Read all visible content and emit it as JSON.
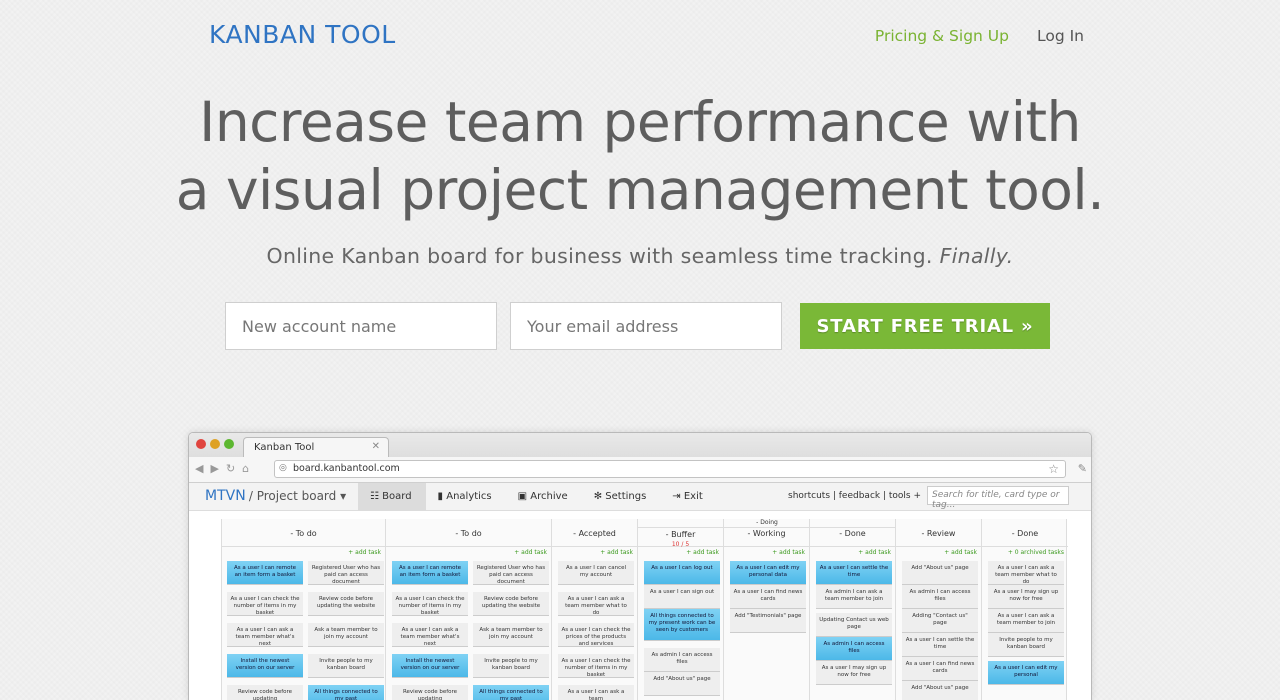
{
  "header": {
    "logo": "KANBAN TOOL",
    "nav": {
      "pricing": "Pricing & Sign Up",
      "login": "Log In"
    }
  },
  "hero": {
    "headline_line1": "Increase team performance with",
    "headline_line2": "a visual project management tool.",
    "subline": "Online Kanban board for business with seamless time tracking.",
    "subline_emphasis": "Finally."
  },
  "signup": {
    "account_placeholder": "New account name",
    "email_placeholder": "Your email address",
    "cta_label": "START FREE TRIAL »"
  },
  "browser": {
    "tab_title": "Kanban Tool",
    "url": "board.kanbantool.com",
    "app": {
      "org": "MTVN",
      "project": "/ Project board ▾",
      "menu": [
        "Board",
        "Analytics",
        "Archive",
        "Settings",
        "Exit"
      ],
      "right_links": "shortcuts | feedback | tools +",
      "search_placeholder": "Search for title, card type or tag...",
      "columns": [
        {
          "name": "- To do",
          "add": "+ add task"
        },
        {
          "name": "- To do",
          "add": "+ add task"
        },
        {
          "name": "- Accepted",
          "add": "+ add task"
        },
        {
          "name": "- Buffer",
          "limit": "10 / 5",
          "add": "+ add task"
        },
        {
          "name": "- Working",
          "add": "+ add task"
        },
        {
          "name": "- Done",
          "add": "+ add task"
        },
        {
          "name": "- Review",
          "add": "+ add task"
        },
        {
          "name": "- Done",
          "add": "+ add task",
          "archived": "+ 0 archived tasks"
        }
      ],
      "doing_group": "- Doing",
      "cards": {
        "c1": [
          "As a user I can remote an item form a basket",
          "As a user I can check the number of items in my basket",
          "As a user I can ask a team member what's next",
          "Install the newest version on our server",
          "Review code before updating"
        ],
        "c2": [
          "Registered User who has paid can access document",
          "Review code before updating the website",
          "Ask a team member to join my account",
          "Invite people to my kanban board",
          "All things connected to my past"
        ],
        "c3": [
          "As a user I can remote an item form a basket",
          "As a user I can check the number of items in my basket",
          "As a user I can ask a team member what's next",
          "Install the newest version on our server",
          "Review code before updating"
        ],
        "c4": [
          "Registered User who has paid can access document",
          "Review code before updating the website",
          "Ask a team member to join my account",
          "Invite people to my kanban board",
          "All things connected to my past"
        ],
        "c5": [
          "As a user I can cancel my account",
          "As a user I can ask a team member what to do",
          "As a user I can check the prices of the products and services",
          "As a user I can check the number of items in my basket",
          "As a user I can ask a team"
        ],
        "c6": [
          "As a user I can log out",
          "As a user I can sign out",
          "All things connected to my present work can be seen by customers",
          "As admin I can access files",
          "Add \"About us\" page"
        ],
        "c7": [
          "As a user I can edit my personal data",
          "As a user I can find news cards",
          "Add \"Testimonials\" page"
        ],
        "c8": [
          "As a user I can settle the time",
          "As admin I can ask a team member to join",
          "Updating Contact us web page",
          "As admin I can access files",
          "As a user I may sign up now for free"
        ],
        "c9": [
          "Add \"About us\" page",
          "As admin I can access files",
          "Adding \"Contact us\" page",
          "As a user I can settle the time",
          "As a user I can find news cards",
          "Add \"About us\" page"
        ],
        "c10": [
          "As a user I can ask a team member what to do",
          "As a user I may sign up now for free",
          "As a user I can ask a team member to join",
          "Invite people to my kanban board",
          "As a user I can edit my personal"
        ]
      }
    }
  }
}
